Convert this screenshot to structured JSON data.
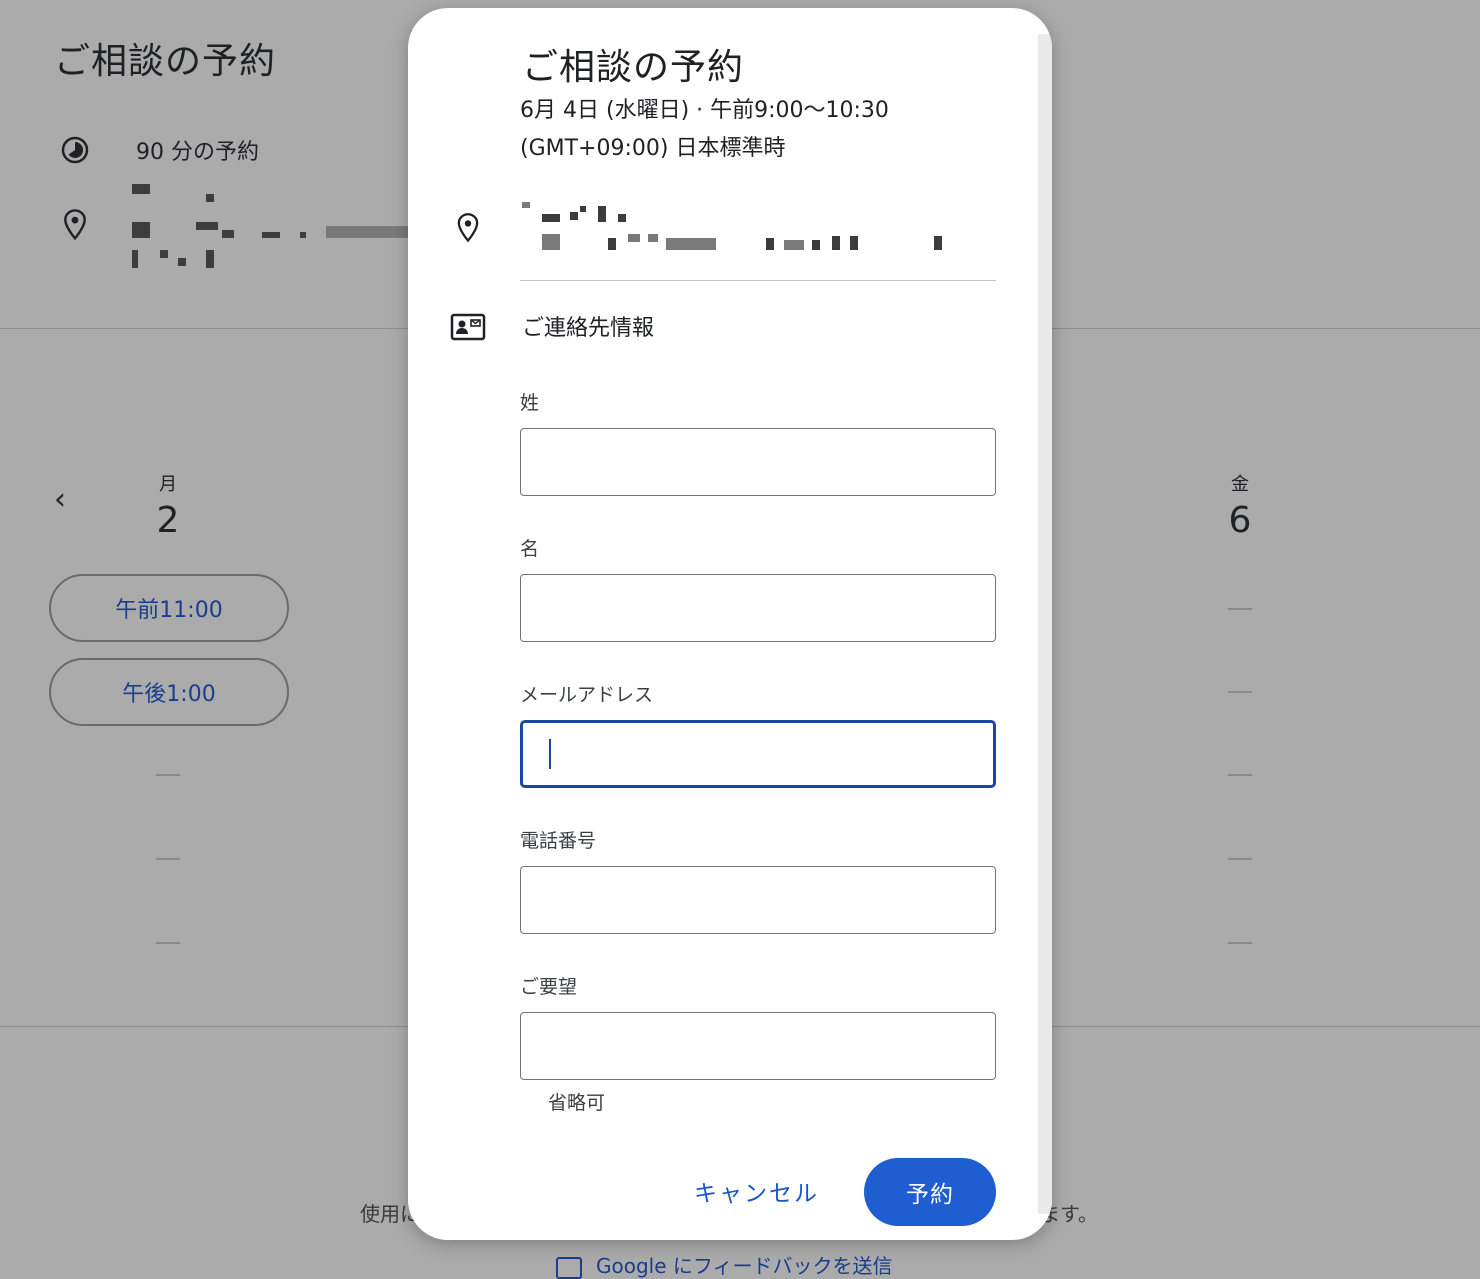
{
  "background": {
    "title": "ご相談の予約",
    "duration": "90 分の予約",
    "prev_label": "‹",
    "days": [
      {
        "dow": "月",
        "num": "2"
      },
      {
        "dow": "金",
        "num": "6"
      }
    ],
    "slots": [
      "午前11:00",
      "午後1:00"
    ],
    "footer_left": "使用に",
    "footer_right": "ます。",
    "feedback": "Google にフィードバックを送信"
  },
  "dialog": {
    "title": "ご相談の予約",
    "date_line": "6月 4日 (水曜日) · 午前9:00〜10:30",
    "timezone": "(GMT+09:00) 日本標準時",
    "contact_heading": "ご連絡先情報",
    "fields": {
      "last_name": {
        "label": "姓",
        "value": ""
      },
      "first_name": {
        "label": "名",
        "value": ""
      },
      "email": {
        "label": "メールアドレス",
        "value": ""
      },
      "phone": {
        "label": "電話番号",
        "value": ""
      },
      "notes": {
        "label": "ご要望",
        "value": "",
        "hint": "省略可"
      }
    },
    "cancel_label": "キャンセル",
    "book_label": "予約"
  },
  "colors": {
    "accent": "#1e5ed1",
    "focus_border": "#1d45a8",
    "overlay": "#ababab"
  }
}
